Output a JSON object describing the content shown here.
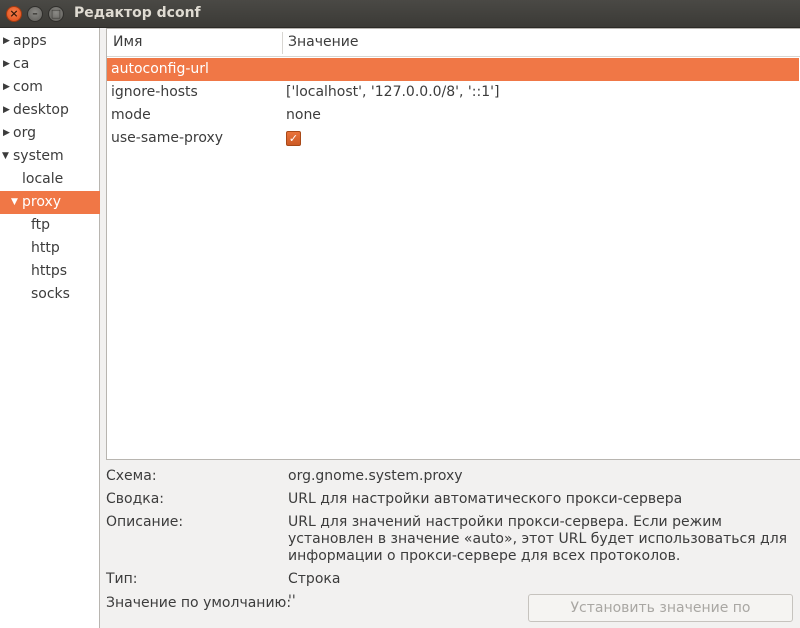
{
  "window": {
    "title": "Редактор dconf"
  },
  "tree": {
    "items": [
      {
        "label": "apps",
        "expander": "▶"
      },
      {
        "label": "ca",
        "expander": "▶"
      },
      {
        "label": "com",
        "expander": "▶"
      },
      {
        "label": "desktop",
        "expander": "▶"
      },
      {
        "label": "org",
        "expander": "▶"
      },
      {
        "label": "system",
        "expander": "▼"
      },
      {
        "label": "locale",
        "expander": ""
      },
      {
        "label": "proxy",
        "expander": "▼",
        "selected": true
      },
      {
        "label": "ftp",
        "expander": ""
      },
      {
        "label": "http",
        "expander": ""
      },
      {
        "label": "https",
        "expander": ""
      },
      {
        "label": "socks",
        "expander": ""
      }
    ]
  },
  "keys": {
    "columns": {
      "name": "Имя",
      "value": "Значение"
    },
    "rows": [
      {
        "name": "autoconfig-url",
        "value": ""
      },
      {
        "name": "ignore-hosts",
        "value": "['localhost', '127.0.0.0/8', '::1']"
      },
      {
        "name": "mode",
        "value": "none"
      },
      {
        "name": "use-same-proxy",
        "value": "",
        "checked": true
      }
    ]
  },
  "details": {
    "schema_label": "Схема:",
    "schema_value": "org.gnome.system.proxy",
    "summary_label": "Сводка:",
    "summary_value": "URL для настройки автоматического прокси-сервера",
    "description_label": "Описание:",
    "description_value": "URL для значений настройки прокси-сервера. Если режим установлен в значение «auto», этот URL будет использоваться для информации о прокси-сервере для всех протоколов.",
    "type_label": "Тип:",
    "type_value": "Строка",
    "default_label": "Значение по умолчанию:",
    "default_value": "''",
    "reset_button": "Установить значение по умолчанию"
  },
  "colors": {
    "accent": "#f07746",
    "titlebar": "#3b3a36"
  },
  "icons": {
    "close": "close-icon",
    "minimize": "minimize-icon",
    "maximize": "maximize-icon",
    "checkbox": "check-icon"
  }
}
